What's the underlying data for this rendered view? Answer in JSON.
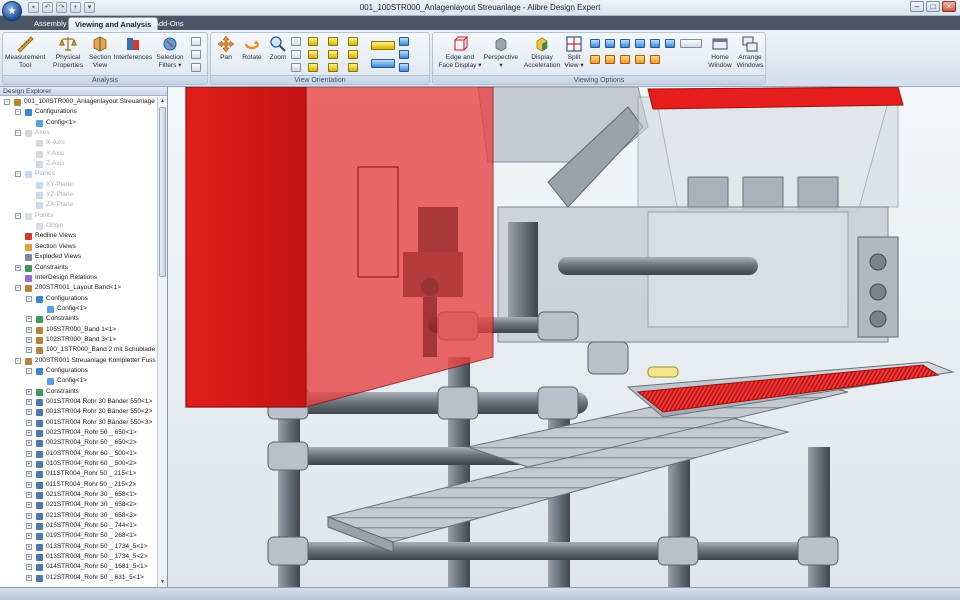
{
  "window": {
    "title": "001_100STR000_Anlagenlayout Streuanlage - Alibre Design Expert"
  },
  "tabs": [
    "Assembly",
    "Viewing and Analysis",
    "Add-Ons"
  ],
  "ribbon": {
    "analysis": {
      "label": "Analysis",
      "buttons": [
        {
          "line1": "Measurement",
          "line2": "Tool"
        },
        {
          "line1": "Physical",
          "line2": "Properties"
        },
        {
          "line1": "Section",
          "line2": "View"
        },
        {
          "line1": "Interferences",
          "line2": ""
        },
        {
          "line1": "Selection",
          "line2": "Filters ▾"
        }
      ]
    },
    "view_orientation": {
      "label": "View Orientation",
      "buttons": [
        "Pan",
        "Rotate",
        "Zoom"
      ]
    },
    "viewing_options": {
      "label": "Viewing Options",
      "buttons": [
        {
          "line1": "Edge and",
          "line2": "Face Display ▾"
        },
        {
          "line1": "Perspective",
          "line2": "▾"
        },
        {
          "line1": "Display",
          "line2": "Acceleration"
        },
        {
          "line1": "Split",
          "line2": "View ▾"
        },
        {
          "line1": "Home",
          "line2": "Window"
        },
        {
          "line1": "Arrange",
          "line2": "Windows"
        }
      ]
    }
  },
  "explorer": {
    "title": "Design Explorer",
    "items": [
      {
        "text": "001_100STR000_Anlagenlayout Streuanlage",
        "level": 0,
        "icon": "assembly",
        "dim": false,
        "exp": "−"
      },
      {
        "text": "Configurations",
        "level": 1,
        "icon": "config",
        "dim": false,
        "exp": "−"
      },
      {
        "text": "Config<1>",
        "level": 2,
        "icon": "config-item",
        "dim": false,
        "exp": ""
      },
      {
        "text": "Axes",
        "level": 1,
        "icon": "axis",
        "dim": true,
        "exp": "−"
      },
      {
        "text": "X-Axis",
        "level": 2,
        "icon": "axis",
        "dim": true,
        "exp": ""
      },
      {
        "text": "Y-Axis",
        "level": 2,
        "icon": "axis",
        "dim": true,
        "exp": ""
      },
      {
        "text": "Z-Axis",
        "level": 2,
        "icon": "axis",
        "dim": true,
        "exp": ""
      },
      {
        "text": "Planes",
        "level": 1,
        "icon": "plane",
        "dim": true,
        "exp": "−"
      },
      {
        "text": "XY-Plane",
        "level": 2,
        "icon": "plane",
        "dim": true,
        "exp": ""
      },
      {
        "text": "YZ-Plane",
        "level": 2,
        "icon": "plane",
        "dim": true,
        "exp": ""
      },
      {
        "text": "ZX-Plane",
        "level": 2,
        "icon": "plane",
        "dim": true,
        "exp": ""
      },
      {
        "text": "Points",
        "level": 1,
        "icon": "point",
        "dim": true,
        "exp": "−"
      },
      {
        "text": "Origin",
        "level": 2,
        "icon": "point",
        "dim": true,
        "exp": ""
      },
      {
        "text": "Redline Views",
        "level": 1,
        "icon": "redline",
        "dim": false,
        "exp": ""
      },
      {
        "text": "Section Views",
        "level": 1,
        "icon": "section",
        "dim": false,
        "exp": ""
      },
      {
        "text": "Exploded Views",
        "level": 1,
        "icon": "exploded",
        "dim": false,
        "exp": ""
      },
      {
        "text": "Constraints",
        "level": 1,
        "icon": "constraint",
        "dim": false,
        "exp": "+"
      },
      {
        "text": "InterDesign Relations",
        "level": 1,
        "icon": "relation",
        "dim": false,
        "exp": ""
      },
      {
        "text": "200STR001_Layout Band<1>",
        "level": 1,
        "icon": "assembly",
        "dim": false,
        "exp": "−"
      },
      {
        "text": "Configurations",
        "level": 2,
        "icon": "config",
        "dim": false,
        "exp": "−"
      },
      {
        "text": "Config<1>",
        "level": 3,
        "icon": "config-item",
        "dim": false,
        "exp": ""
      },
      {
        "text": "Constraints",
        "level": 2,
        "icon": "constraint",
        "dim": false,
        "exp": "+"
      },
      {
        "text": "105STR000_Band 1<1>",
        "level": 2,
        "icon": "assembly",
        "dim": false,
        "exp": "+"
      },
      {
        "text": "102STR000_Band 3<1>",
        "level": 2,
        "icon": "assembly",
        "dim": false,
        "exp": "+"
      },
      {
        "text": "100_1STR000_Band 2 mit Schublade",
        "level": 2,
        "icon": "assembly",
        "dim": false,
        "exp": "+"
      },
      {
        "text": "200STR001 Streuanlage Kompletter Fuss",
        "level": 1,
        "icon": "assembly",
        "dim": false,
        "exp": "−"
      },
      {
        "text": "Configurations",
        "level": 2,
        "icon": "config",
        "dim": false,
        "exp": "−"
      },
      {
        "text": "Config<1>",
        "level": 3,
        "icon": "config-item",
        "dim": false,
        "exp": ""
      },
      {
        "text": "Constraints",
        "level": 2,
        "icon": "constraint",
        "dim": false,
        "exp": "+"
      },
      {
        "text": "001STR004 Rohr 30 Bänder 550<1>",
        "level": 2,
        "icon": "part",
        "dim": false,
        "exp": "+"
      },
      {
        "text": "001STR004 Rohr 30 Bänder 550<2>",
        "level": 2,
        "icon": "part",
        "dim": false,
        "exp": "+"
      },
      {
        "text": "001STR004 Rohr 30 Bänder 550<3>",
        "level": 2,
        "icon": "part",
        "dim": false,
        "exp": "+"
      },
      {
        "text": "002STR004_Rohr 50 _ 650<1>",
        "level": 2,
        "icon": "part",
        "dim": false,
        "exp": "+"
      },
      {
        "text": "002STR004_Rohr 50 _ 650<2>",
        "level": 2,
        "icon": "part",
        "dim": false,
        "exp": "+"
      },
      {
        "text": "010STR004_Rohr 60 _ 500<1>",
        "level": 2,
        "icon": "part",
        "dim": false,
        "exp": "+"
      },
      {
        "text": "010STR004_Rohr 60 _ 500<2>",
        "level": 2,
        "icon": "part",
        "dim": false,
        "exp": "+"
      },
      {
        "text": "011STR004_Rohr 50 _ 215<1>",
        "level": 2,
        "icon": "part",
        "dim": false,
        "exp": "+"
      },
      {
        "text": "011STR004_Rohr 50 _ 215<2>",
        "level": 2,
        "icon": "part",
        "dim": false,
        "exp": "+"
      },
      {
        "text": "021STR004_Rohr 30 _ 658<1>",
        "level": 2,
        "icon": "part",
        "dim": false,
        "exp": "+"
      },
      {
        "text": "021STR004_Rohr 30 _ 658<2>",
        "level": 2,
        "icon": "part",
        "dim": false,
        "exp": "+"
      },
      {
        "text": "021STR004_Rohr 30 _ 658<3>",
        "level": 2,
        "icon": "part",
        "dim": false,
        "exp": "+"
      },
      {
        "text": "015STR004_Rohr 50 _ 744<1>",
        "level": 2,
        "icon": "part",
        "dim": false,
        "exp": "+"
      },
      {
        "text": "019STR004_Rohr 50 _ 268<1>",
        "level": 2,
        "icon": "part",
        "dim": false,
        "exp": "+"
      },
      {
        "text": "013STR004_Rohr 50 _ 1734_5<1>",
        "level": 2,
        "icon": "part",
        "dim": false,
        "exp": "+"
      },
      {
        "text": "013STR004_Rohr 50 _ 1734_5<2>",
        "level": 2,
        "icon": "part",
        "dim": false,
        "exp": "+"
      },
      {
        "text": "014STR004_Rohr 50 _ 1681_5<1>",
        "level": 2,
        "icon": "part",
        "dim": false,
        "exp": "+"
      },
      {
        "text": "012STR004_Rohr 50 _ 631_5<1>",
        "level": 2,
        "icon": "part",
        "dim": false,
        "exp": "+"
      }
    ]
  },
  "colors": {
    "selected_red": "#e01c1c",
    "steel": "#b7bec6",
    "pipe_dark": "#6f7780",
    "viewport_bg": "#eef2f5"
  }
}
